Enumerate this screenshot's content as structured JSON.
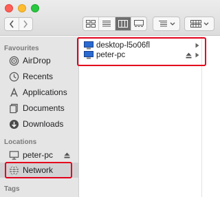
{
  "toolbar": {
    "window_buttons": [
      "close",
      "minimize",
      "zoom"
    ],
    "views": [
      "icon-view",
      "list-view",
      "column-view",
      "gallery-view"
    ],
    "active_view": "column-view"
  },
  "sidebar": {
    "favourites_title": "Favourites",
    "favourites": [
      {
        "label": "AirDrop",
        "icon": "airdrop-icon"
      },
      {
        "label": "Recents",
        "icon": "clock-icon"
      },
      {
        "label": "Applications",
        "icon": "applications-icon"
      },
      {
        "label": "Documents",
        "icon": "documents-icon"
      },
      {
        "label": "Downloads",
        "icon": "downloads-icon"
      }
    ],
    "locations_title": "Locations",
    "locations": [
      {
        "label": "peter-pc",
        "icon": "computer-icon"
      },
      {
        "label": "Network",
        "icon": "network-globe-icon"
      }
    ],
    "tags_title": "Tags"
  },
  "content": {
    "items": [
      {
        "name": "desktop-l5o06fl",
        "icon": "computer-icon"
      },
      {
        "name": "peter-pc",
        "icon": "computer-icon"
      }
    ]
  },
  "colors": {
    "highlight": "#e3001b",
    "sidebar_bg": "#e6e5e6",
    "selected_bg": "#d2d2d4"
  }
}
